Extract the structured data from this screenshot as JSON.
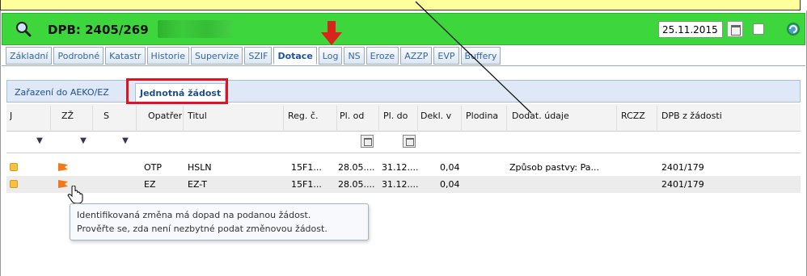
{
  "header": {
    "title": "DPB: 2405/269",
    "date_value": "25.11.2015"
  },
  "tabs": [
    "Základní",
    "Podrobné",
    "Katastr",
    "Historie",
    "Supervize",
    "SZIF",
    "Dotace",
    "Log",
    "NS",
    "Eroze",
    "AZZP",
    "EVP",
    "Buffery"
  ],
  "active_tab": "Dotace",
  "subtabs": [
    "Zařazení do AEKO/EZ",
    "Jednotná žádost"
  ],
  "grid": {
    "columns": [
      "J",
      "ZŽ",
      "S",
      "Opatření",
      "Titul",
      "Reg. č.",
      "Pl. od",
      "Pl. do",
      "Dekl. v",
      "Plodina",
      "Dodat. údaje",
      "RCZZ",
      "DPB z žádosti"
    ],
    "rows": [
      {
        "opatreni": "OTP",
        "titul": "HSLN",
        "reg": "15F1...",
        "pl_od": "28.05....",
        "pl_do": "31.12....",
        "dekl": "0,04",
        "plodina": "",
        "dodat": "Způsob pastvy: Pa...",
        "rczz": "",
        "dpb": "2401/179"
      },
      {
        "opatreni": "EZ",
        "titul": "EZ-T",
        "reg": "15F1...",
        "pl_od": "28.05....",
        "pl_do": "31.12....",
        "dekl": "0,04",
        "plodina": "",
        "dodat": "",
        "rczz": "",
        "dpb": "2401/179"
      }
    ]
  },
  "tooltip": {
    "line1": "Identifikovaná změna má dopad na podanou žádost.",
    "line2": "Prověřte se, zda není nezbytné podat změnovou žádost."
  },
  "colors": {
    "header_green": "#3dd63d",
    "highlight_red": "#e0141e",
    "flag_orange": "#f07a1a",
    "callout_yellow": "#ffff9c"
  }
}
